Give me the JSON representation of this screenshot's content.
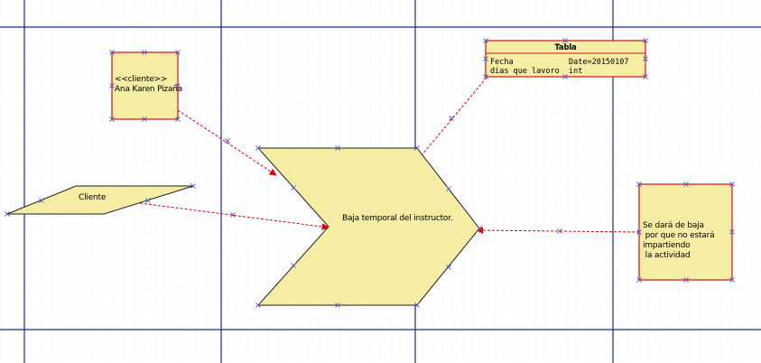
{
  "diagram": {
    "actor_note": {
      "stereotype": "<<cliente>>",
      "name": "Ana Karen Pizaña"
    },
    "client_input": {
      "label": "Cliente"
    },
    "process": {
      "label": "Baja temporal del instructor."
    },
    "data_table": {
      "title": "Tabla",
      "rows": [
        "Fecha            Date=20150107",
        "dias que lavoro  int"
      ]
    },
    "output_note": {
      "lines": [
        "Se dará de baja",
        " por que no estará",
        "impartiendo",
        " la actividad"
      ]
    }
  },
  "colors": {
    "shape_fill": "#f5eda3",
    "note_border": "#d01018",
    "connector": "#e00000",
    "grid_major": "#1a2a8a",
    "grid_minor": "#c8ccd8",
    "handle": "#5a5ad8"
  }
}
